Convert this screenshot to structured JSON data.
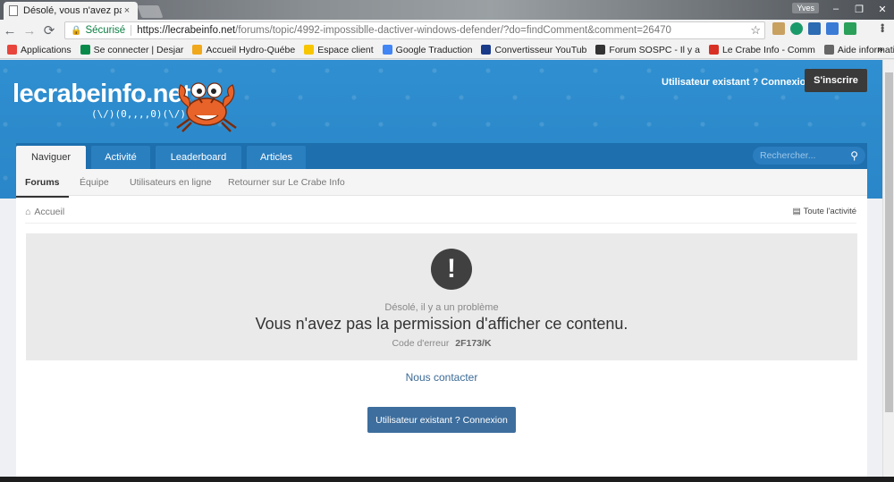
{
  "browser": {
    "tab_title": "Désolé, vous n'avez pas",
    "tab_close": "×",
    "user_badge": "Yves",
    "window_controls": [
      "–",
      "❐",
      "✕"
    ],
    "secure_label": "Sécurisé",
    "url_host": "https://lecrabeinfo.net",
    "url_path": "/forums/topic/4992-impossiblle-dactiver-windows-defender/?do=findComment&comment=26470",
    "bookmarks": [
      {
        "label": "Applications",
        "color": "#e8453c"
      },
      {
        "label": "Se connecter | Desjar",
        "color": "#0a8a4a"
      },
      {
        "label": "Accueil Hydro-Québe",
        "color": "#f0a81c"
      },
      {
        "label": "Espace client",
        "color": "#f7c600"
      },
      {
        "label": "Google Traduction",
        "color": "#4285f4"
      },
      {
        "label": "Convertisseur YouTub",
        "color": "#1a3a8a"
      },
      {
        "label": "Forum SOSPC - Il y a",
        "color": "#333333"
      },
      {
        "label": "Le Crabe Info - Comm",
        "color": "#d93025"
      },
      {
        "label": "Aide informatique en",
        "color": "#666666"
      }
    ],
    "bookmarks_more": "»"
  },
  "site": {
    "logo": "lecrabeinfo.net",
    "logo_sub": "(\\/)(0,,,,0)(\\/)",
    "existing_user": "Utilisateur existant ? Connexion",
    "signup": "S'inscrire",
    "nav_tabs": [
      "Naviguer",
      "Activité",
      "Leaderboard",
      "Articles"
    ],
    "search_placeholder": "Rechercher...",
    "subnav": [
      "Forums",
      "Équipe",
      "Utilisateurs en ligne",
      "Retourner sur Le Crabe Info"
    ],
    "breadcrumb": "Accueil",
    "all_activity": "Toute l'activité"
  },
  "error": {
    "subtitle": "Désolé, il y a un problème",
    "message": "Vous n'avez pas la permission d'afficher ce contenu.",
    "code_label": "Code d'erreur",
    "code": "2F173/K"
  },
  "contact": "Nous contacter",
  "login_button": "Utilisateur existant ? Connexion",
  "colors": {
    "header_blue": "#2a86c8",
    "nav_blue": "#1d6fad",
    "button_blue": "#3d6e9e",
    "signup_dark": "#3a3a3a"
  }
}
